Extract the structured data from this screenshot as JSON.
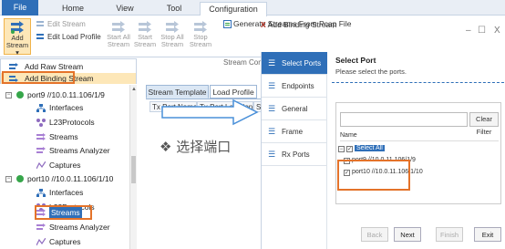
{
  "ribbon": {
    "tabs": [
      "File",
      "Home",
      "View",
      "Tool",
      "Configuration"
    ],
    "add_stream": [
      "Add",
      "Stream ▾"
    ],
    "edit_stream": "Edit Stream",
    "edit_load_profile": "Edit Load Profile",
    "start_all": [
      "Start All",
      "Stream"
    ],
    "start": [
      "Start",
      "Stream"
    ],
    "stop_all": [
      "Stop All",
      "Stream"
    ],
    "stop": [
      "Stop",
      "Stream"
    ],
    "generate_pcap": "Generate Streams From Pcap File",
    "group_label": "Stream Con"
  },
  "menu": {
    "add_raw": "Add Raw Stream",
    "add_binding": "Add Binding Stream"
  },
  "tree": {
    "port9": "port9 //10.0.11.106/1/9",
    "port10": "port10 //10.0.11.106/1/10",
    "interfaces": "Interfaces",
    "l23": "L23Protocols",
    "streams": "Streams",
    "analyzer": "Streams Analyzer",
    "captures": "Captures"
  },
  "middle": {
    "tabs": [
      "Stream Template",
      "Load Profile"
    ],
    "columns": [
      "Tx Port Name",
      "Tx Port Location",
      "S"
    ],
    "placeholder": "❖ 选择端口"
  },
  "window": {
    "minimize": "–",
    "maximize": "☐",
    "close": "X"
  },
  "wizard": {
    "title": "Add Binding Stream",
    "nav": [
      "Select Ports",
      "Endpoints",
      "General",
      "Frame",
      "Rx Ports"
    ],
    "heading": "Select Port",
    "subheading": "Please select the ports.",
    "clear_filter": "Clear Filter",
    "name_header": "Name",
    "select_all": "Select All",
    "ports": [
      "port9 //10.0.11.106/1/9",
      "port10 //10.0.11.106/1/10"
    ],
    "buttons": {
      "back": "Back",
      "next": "Next",
      "finish": "Finish",
      "exit": "Exit"
    }
  }
}
